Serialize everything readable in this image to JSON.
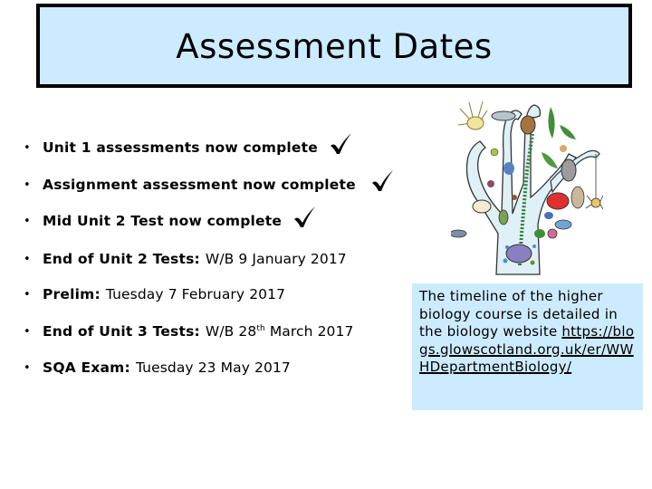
{
  "title": "Assessment Dates",
  "colors": {
    "box_fill": "#cdebff",
    "border": "#000000",
    "text": "#000000"
  },
  "bullets": [
    {
      "label": "Unit 1 assessments now complete",
      "value": "",
      "completed": true
    },
    {
      "label": "Assignment assessment now complete",
      "value": "",
      "completed": true
    },
    {
      "label": "Mid Unit 2 Test now complete",
      "value": "",
      "completed": true
    },
    {
      "label": "End of Unit 2 Tests:",
      "value": "W/B 9 January 2017",
      "completed": false
    },
    {
      "label": "Prelim:",
      "value": "Tuesday 7 February 2017",
      "completed": false
    },
    {
      "label": "End of Unit 3 Tests:",
      "value_prefix": "W/B 28",
      "value_sup": "th",
      "value_suffix": " March 2017",
      "completed": false
    },
    {
      "label": "SQA Exam:",
      "value": "Tuesday 23 May 2017",
      "completed": false
    }
  ],
  "bullet_glyph": "•",
  "check_icon": "check-mark-icon",
  "info": {
    "text": "The timeline of the higher biology course is detailed in the biology website",
    "link": "https://blogs.glowscotland.org.uk/er/WWHDepartmentBiology/"
  },
  "illustration": {
    "icon": "tree-of-life-illustration"
  }
}
